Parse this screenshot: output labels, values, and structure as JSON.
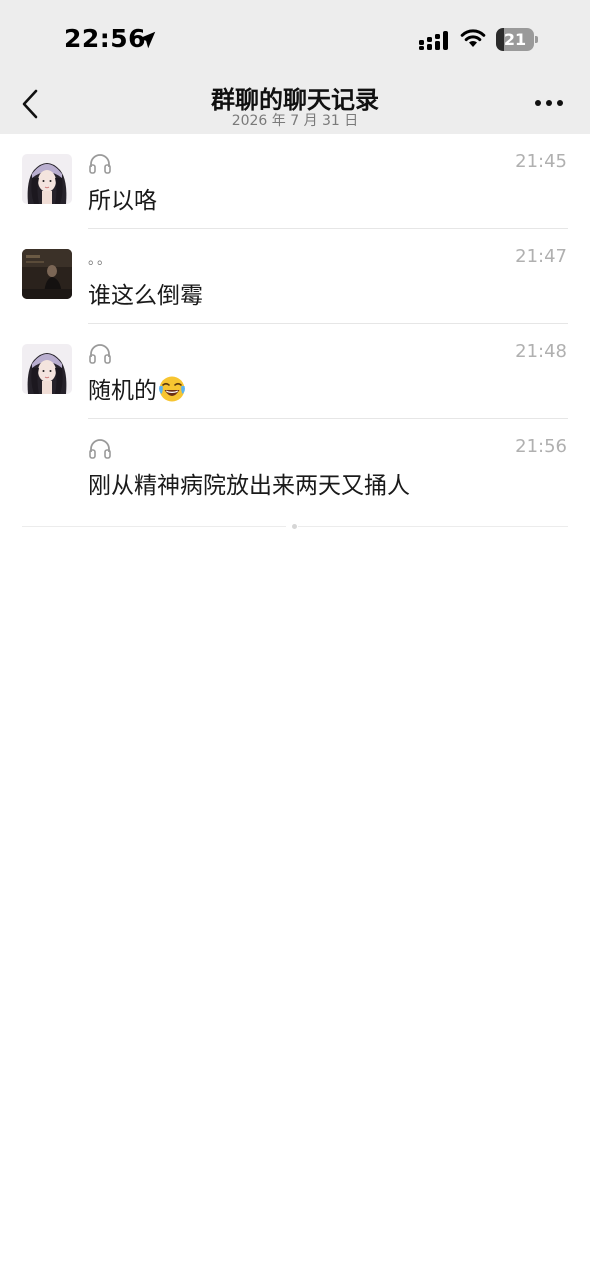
{
  "status_bar": {
    "time": "22:56",
    "battery_level": "21",
    "battery_fraction": 0.21
  },
  "nav": {
    "title": "群聊的聊天记录",
    "subtitle": "2026 年 7 月 31 日"
  },
  "messages": [
    {
      "sender": "",
      "time": "21:45",
      "text": "所以咯"
    },
    {
      "sender": "。。",
      "time": "21:47",
      "text": "谁这么倒霉"
    },
    {
      "sender": "",
      "time": "21:48",
      "text": "随机的",
      "emoji": "face-with-tears-of-joy"
    },
    {
      "sender": "",
      "time": "21:56",
      "text": "刚从精神病院放出来两天又捅人"
    }
  ],
  "icons": {
    "back": "chevron-left-icon",
    "more": "more-dots-icon",
    "sender_badge": "headphones-icon"
  },
  "colors": {
    "header_bg": "#ededed",
    "time_gray": "#b0b0b0",
    "text": "#1a1a1a"
  }
}
